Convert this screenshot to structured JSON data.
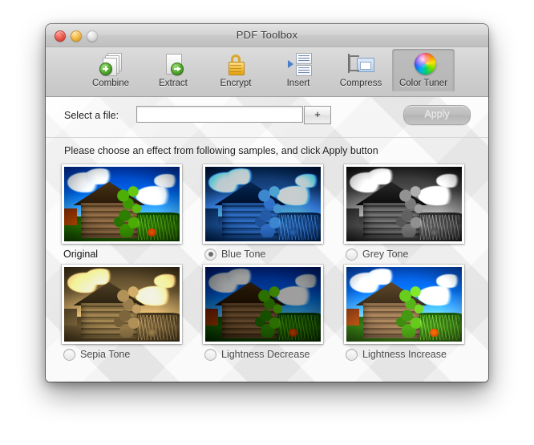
{
  "window": {
    "title": "PDF Toolbox",
    "traffic_lights": [
      {
        "name": "close",
        "color": "#e8554a"
      },
      {
        "name": "minimize",
        "color": "#f0b53f"
      },
      {
        "name": "zoom",
        "color": "#dcdcdc"
      }
    ]
  },
  "toolbar": {
    "items": [
      {
        "label": "Combine",
        "icon": "combine-icon",
        "selected": false
      },
      {
        "label": "Extract",
        "icon": "extract-icon",
        "selected": false
      },
      {
        "label": "Encrypt",
        "icon": "encrypt-lock-icon",
        "selected": false
      },
      {
        "label": "Insert",
        "icon": "insert-icon",
        "selected": false
      },
      {
        "label": "Compress",
        "icon": "compress-icon",
        "selected": false
      },
      {
        "label": "Color Tuner",
        "icon": "color-wheel-icon",
        "selected": true
      }
    ]
  },
  "file_row": {
    "label": "Select a file:",
    "input_value": "",
    "input_placeholder": "",
    "add_button_label": "+",
    "apply_button_label": "Apply",
    "apply_enabled": false
  },
  "instruction": "Please choose an effect from following samples, and click Apply button",
  "samples": [
    {
      "label": "Original",
      "effect": "original",
      "has_radio": false,
      "selected": false
    },
    {
      "label": "Blue Tone",
      "effect": "blue",
      "has_radio": true,
      "selected": true
    },
    {
      "label": "Grey Tone",
      "effect": "grey",
      "has_radio": true,
      "selected": false
    },
    {
      "label": "Sepia Tone",
      "effect": "sepia",
      "has_radio": true,
      "selected": false
    },
    {
      "label": "Lightness Decrease",
      "effect": "dark",
      "has_radio": true,
      "selected": false
    },
    {
      "label": "Lightness Increase",
      "effect": "light",
      "has_radio": true,
      "selected": false
    }
  ],
  "colors": {
    "window_background": "#ececec",
    "titlebar": "#d2d2d2",
    "toolbar": "#d0d0d0",
    "content_background": "#f0f0f0",
    "selected_tab": "#b8b8b8",
    "apply_disabled_text": "#eaeaea"
  }
}
